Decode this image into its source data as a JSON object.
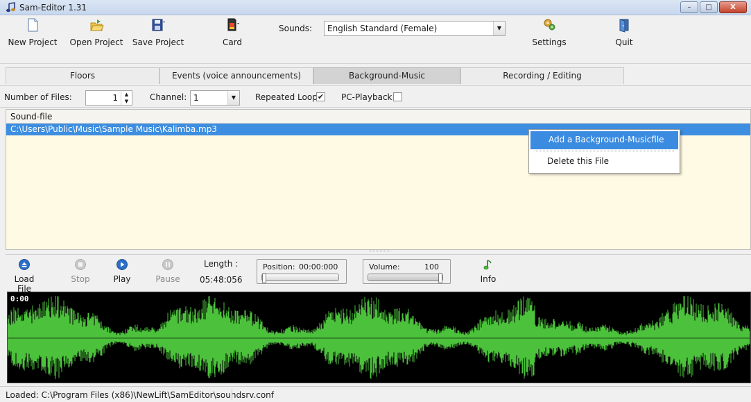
{
  "window": {
    "title": "Sam-Editor 1.31"
  },
  "titlebar_buttons": {
    "minimize": "–",
    "maximize": "□",
    "close": "X"
  },
  "toolbar": {
    "new_project": "New Project",
    "open_project": "Open Project",
    "save_project": "Save Project",
    "card": "Card",
    "sounds_label": "Sounds:",
    "sounds_value": "English Standard (Female)",
    "settings": "Settings",
    "quit": "Quit"
  },
  "tabs": [
    {
      "label": "Floors",
      "active": false
    },
    {
      "label": "Events  (voice announcements)",
      "active": false
    },
    {
      "label": "Background-Music",
      "active": true
    },
    {
      "label": "Recording / Editing",
      "active": false
    }
  ],
  "options": {
    "num_files_label": "Number of Files:",
    "num_files_value": "1",
    "channel_label": "Channel:",
    "channel_value": "1",
    "repeated_loop_label": "Repeated Loop:",
    "repeated_loop_checked": true,
    "pc_playback_label": "PC-Playback:",
    "pc_playback_checked": false
  },
  "list": {
    "header": "Sound-file",
    "rows": [
      "C:\\Users\\Public\\Music\\Sample Music\\Kalimba.mp3"
    ]
  },
  "context_menu": {
    "items": [
      "Add a Background-Musicfile",
      "Delete this File"
    ]
  },
  "player": {
    "load_file": "Load File",
    "stop": "Stop",
    "play": "Play",
    "pause": "Pause",
    "length_label": "Length :",
    "length_value": "05:48:056",
    "position_label": "Position:",
    "position_value": "00:00:000",
    "position_fraction": 0,
    "volume_label": "Volume:",
    "volume_value": "100",
    "volume_fraction": 1,
    "info": "Info"
  },
  "waveform": {
    "time_label": "0:00",
    "color": "#4cc13c"
  },
  "status": {
    "text": "Loaded:   C:\\Program Files (x86)\\NewLift\\SamEditor\\soundsrv.conf"
  },
  "colors": {
    "selection": "#3d8ee0",
    "list_bg": "#fffae3",
    "menu_highlight": "#3b8be1"
  },
  "icons": {
    "app": "music-note-icon",
    "new_project": "new-document-icon",
    "open_project": "open-folder-icon",
    "save_project": "floppy-disk-icon",
    "card": "sd-card-icon",
    "settings": "settings-gears-icon",
    "quit": "exit-door-icon",
    "load_file": "eject-icon",
    "stop": "stop-icon",
    "play": "play-icon",
    "pause": "pause-icon",
    "info": "music-note-icon"
  }
}
